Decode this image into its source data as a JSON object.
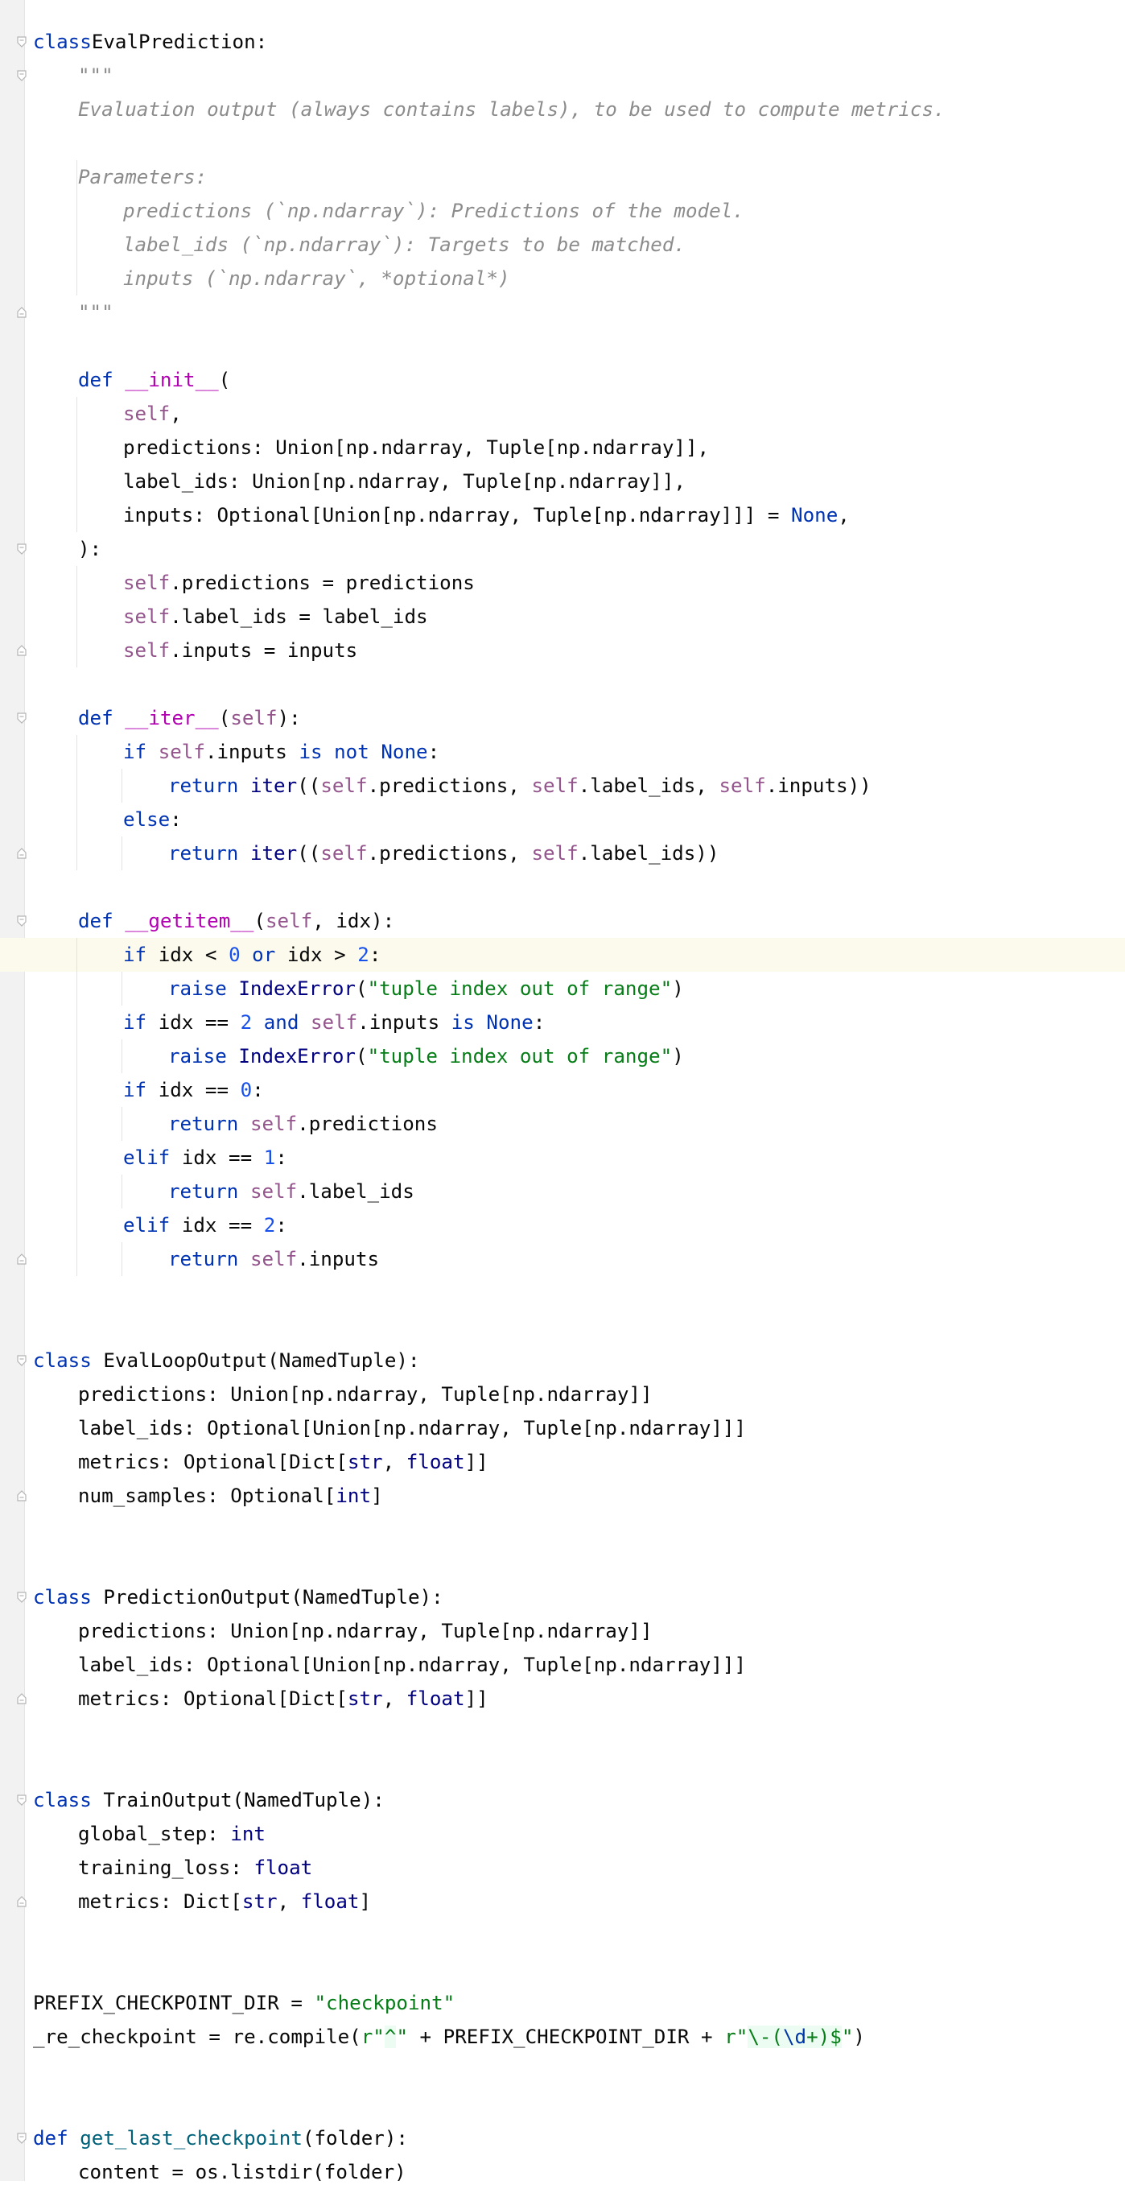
{
  "editor": {
    "current_line_index": 27,
    "lines": [
      {
        "indent": 0,
        "fold": "open",
        "tokens": [
          [
            "k",
            "class"
          ],
          [
            "",
            "EvalPrediction:"
          ]
        ]
      },
      {
        "indent": 1,
        "fold": "open",
        "tokens": [
          [
            "dc",
            "\"\"\""
          ]
        ]
      },
      {
        "indent": 1,
        "fold": "",
        "tokens": [
          [
            "dc",
            "Evaluation output (always contains labels), to be used to compute metrics."
          ]
        ]
      },
      {
        "indent": 0,
        "fold": "",
        "tokens": []
      },
      {
        "indent": 1,
        "fold": "",
        "tokens": [
          [
            "dc",
            "Parameters:"
          ]
        ]
      },
      {
        "indent": 2,
        "fold": "",
        "tokens": [
          [
            "dc",
            "predictions (`np.ndarray`): Predictions of the model."
          ]
        ]
      },
      {
        "indent": 2,
        "fold": "",
        "tokens": [
          [
            "dc",
            "label_ids (`np.ndarray`): Targets to be matched."
          ]
        ]
      },
      {
        "indent": 2,
        "fold": "",
        "tokens": [
          [
            "dc",
            "inputs (`np.ndarray`, *optional*)"
          ]
        ]
      },
      {
        "indent": 1,
        "fold": "close",
        "tokens": [
          [
            "dc",
            "\"\"\""
          ]
        ]
      },
      {
        "indent": 0,
        "fold": "",
        "tokens": []
      },
      {
        "indent": 1,
        "fold": "",
        "tokens": [
          [
            "k",
            "def "
          ],
          [
            "mg",
            "__init__"
          ],
          [
            "",
            "("
          ]
        ]
      },
      {
        "indent": 2,
        "fold": "",
        "tokens": [
          [
            "sf",
            "self"
          ],
          [
            "",
            ","
          ]
        ]
      },
      {
        "indent": 2,
        "fold": "",
        "tokens": [
          [
            "",
            "predictions: Union[np.ndarray, Tuple[np.ndarray]],"
          ]
        ]
      },
      {
        "indent": 2,
        "fold": "",
        "tokens": [
          [
            "",
            "label_ids: Union[np.ndarray, Tuple[np.ndarray]],"
          ]
        ]
      },
      {
        "indent": 2,
        "fold": "",
        "tokens": [
          [
            "",
            "inputs: Optional[Union[np.ndarray, Tuple[np.ndarray]]] = "
          ],
          [
            "k",
            "None"
          ],
          [
            "",
            ","
          ]
        ]
      },
      {
        "indent": 1,
        "fold": "open",
        "tokens": [
          [
            "",
            "):"
          ]
        ]
      },
      {
        "indent": 2,
        "fold": "",
        "tokens": [
          [
            "sf",
            "self"
          ],
          [
            "",
            ".predictions = predictions"
          ]
        ]
      },
      {
        "indent": 2,
        "fold": "",
        "tokens": [
          [
            "sf",
            "self"
          ],
          [
            "",
            ".label_ids = label_ids"
          ]
        ]
      },
      {
        "indent": 2,
        "fold": "close",
        "tokens": [
          [
            "sf",
            "self"
          ],
          [
            "",
            ".inputs = inputs"
          ]
        ]
      },
      {
        "indent": 0,
        "fold": "",
        "tokens": []
      },
      {
        "indent": 1,
        "fold": "open",
        "tokens": [
          [
            "k",
            "def "
          ],
          [
            "mg",
            "__iter__"
          ],
          [
            "",
            "("
          ],
          [
            "sf",
            "self"
          ],
          [
            "",
            "):"
          ]
        ]
      },
      {
        "indent": 2,
        "fold": "",
        "tokens": [
          [
            "k",
            "if "
          ],
          [
            "sf",
            "self"
          ],
          [
            "",
            ".inputs "
          ],
          [
            "k",
            "is not None"
          ],
          [
            "",
            ":"
          ]
        ]
      },
      {
        "indent": 3,
        "fold": "",
        "tokens": [
          [
            "k",
            "return "
          ],
          [
            "b",
            "iter"
          ],
          [
            "",
            "(("
          ],
          [
            "sf",
            "self"
          ],
          [
            "",
            ".predictions, "
          ],
          [
            "sf",
            "self"
          ],
          [
            "",
            ".label_ids, "
          ],
          [
            "sf",
            "self"
          ],
          [
            "",
            ".inputs))"
          ]
        ]
      },
      {
        "indent": 2,
        "fold": "",
        "tokens": [
          [
            "k",
            "else"
          ],
          [
            "",
            ":"
          ]
        ]
      },
      {
        "indent": 3,
        "fold": "close",
        "tokens": [
          [
            "k",
            "return "
          ],
          [
            "b",
            "iter"
          ],
          [
            "",
            "(("
          ],
          [
            "sf",
            "self"
          ],
          [
            "",
            ".predictions, "
          ],
          [
            "sf",
            "self"
          ],
          [
            "",
            ".label_ids))"
          ]
        ]
      },
      {
        "indent": 0,
        "fold": "",
        "tokens": []
      },
      {
        "indent": 1,
        "fold": "open",
        "tokens": [
          [
            "k",
            "def "
          ],
          [
            "mg",
            "__getitem__"
          ],
          [
            "",
            "("
          ],
          [
            "sf",
            "self"
          ],
          [
            "",
            ", idx):"
          ]
        ]
      },
      {
        "indent": 2,
        "fold": "",
        "tokens": [
          [
            "k",
            "if "
          ],
          [
            "",
            "idx < "
          ],
          [
            "nm",
            "0"
          ],
          [
            "k",
            " or "
          ],
          [
            "",
            "idx > "
          ],
          [
            "nm",
            "2"
          ],
          [
            "",
            ":"
          ]
        ]
      },
      {
        "indent": 3,
        "fold": "",
        "tokens": [
          [
            "k",
            "raise "
          ],
          [
            "b",
            "IndexError"
          ],
          [
            "",
            "("
          ],
          [
            "st",
            "\"tuple index out of range\""
          ],
          [
            "",
            ")"
          ]
        ]
      },
      {
        "indent": 2,
        "fold": "",
        "tokens": [
          [
            "k",
            "if "
          ],
          [
            "",
            "idx == "
          ],
          [
            "nm",
            "2"
          ],
          [
            "k",
            " and "
          ],
          [
            "sf",
            "self"
          ],
          [
            "",
            ".inputs "
          ],
          [
            "k",
            "is None"
          ],
          [
            "",
            ":"
          ]
        ]
      },
      {
        "indent": 3,
        "fold": "",
        "tokens": [
          [
            "k",
            "raise "
          ],
          [
            "b",
            "IndexError"
          ],
          [
            "",
            "("
          ],
          [
            "st",
            "\"tuple index out of range\""
          ],
          [
            "",
            ")"
          ]
        ]
      },
      {
        "indent": 2,
        "fold": "",
        "tokens": [
          [
            "k",
            "if "
          ],
          [
            "",
            "idx == "
          ],
          [
            "nm",
            "0"
          ],
          [
            "",
            ":"
          ]
        ]
      },
      {
        "indent": 3,
        "fold": "",
        "tokens": [
          [
            "k",
            "return "
          ],
          [
            "sf",
            "self"
          ],
          [
            "",
            ".predictions"
          ]
        ]
      },
      {
        "indent": 2,
        "fold": "",
        "tokens": [
          [
            "k",
            "elif "
          ],
          [
            "",
            "idx == "
          ],
          [
            "nm",
            "1"
          ],
          [
            "",
            ":"
          ]
        ]
      },
      {
        "indent": 3,
        "fold": "",
        "tokens": [
          [
            "k",
            "return "
          ],
          [
            "sf",
            "self"
          ],
          [
            "",
            ".label_ids"
          ]
        ]
      },
      {
        "indent": 2,
        "fold": "",
        "tokens": [
          [
            "k",
            "elif "
          ],
          [
            "",
            "idx == "
          ],
          [
            "nm",
            "2"
          ],
          [
            "",
            ":"
          ]
        ]
      },
      {
        "indent": 3,
        "fold": "close",
        "tokens": [
          [
            "k",
            "return "
          ],
          [
            "sf",
            "self"
          ],
          [
            "",
            ".inputs"
          ]
        ]
      },
      {
        "indent": 0,
        "fold": "",
        "tokens": []
      },
      {
        "indent": 0,
        "fold": "",
        "tokens": []
      },
      {
        "indent": 0,
        "fold": "open",
        "tokens": [
          [
            "k",
            "class "
          ],
          [
            "",
            "EvalLoopOutput(NamedTuple):"
          ]
        ]
      },
      {
        "indent": 1,
        "fold": "",
        "tokens": [
          [
            "",
            "predictions: Union[np.ndarray, Tuple[np.ndarray]]"
          ]
        ]
      },
      {
        "indent": 1,
        "fold": "",
        "tokens": [
          [
            "",
            "label_ids: Optional[Union[np.ndarray, Tuple[np.ndarray]]]"
          ]
        ]
      },
      {
        "indent": 1,
        "fold": "",
        "tokens": [
          [
            "",
            "metrics: Optional[Dict["
          ],
          [
            "b",
            "str"
          ],
          [
            "",
            ", "
          ],
          [
            "b",
            "float"
          ],
          [
            "",
            "]]"
          ]
        ]
      },
      {
        "indent": 1,
        "fold": "close",
        "tokens": [
          [
            "",
            "num_samples: Optional["
          ],
          [
            "b",
            "int"
          ],
          [
            "",
            "]"
          ]
        ]
      },
      {
        "indent": 0,
        "fold": "",
        "tokens": []
      },
      {
        "indent": 0,
        "fold": "",
        "tokens": []
      },
      {
        "indent": 0,
        "fold": "open",
        "tokens": [
          [
            "k",
            "class "
          ],
          [
            "",
            "PredictionOutput(NamedTuple):"
          ]
        ]
      },
      {
        "indent": 1,
        "fold": "",
        "tokens": [
          [
            "",
            "predictions: Union[np.ndarray, Tuple[np.ndarray]]"
          ]
        ]
      },
      {
        "indent": 1,
        "fold": "",
        "tokens": [
          [
            "",
            "label_ids: Optional[Union[np.ndarray, Tuple[np.ndarray]]]"
          ]
        ]
      },
      {
        "indent": 1,
        "fold": "close",
        "tokens": [
          [
            "",
            "metrics: Optional[Dict["
          ],
          [
            "b",
            "str"
          ],
          [
            "",
            ", "
          ],
          [
            "b",
            "float"
          ],
          [
            "",
            "]]"
          ]
        ]
      },
      {
        "indent": 0,
        "fold": "",
        "tokens": []
      },
      {
        "indent": 0,
        "fold": "",
        "tokens": []
      },
      {
        "indent": 0,
        "fold": "open",
        "tokens": [
          [
            "k",
            "class "
          ],
          [
            "",
            "TrainOutput(NamedTuple):"
          ]
        ]
      },
      {
        "indent": 1,
        "fold": "",
        "tokens": [
          [
            "",
            "global_step: "
          ],
          [
            "b",
            "int"
          ]
        ]
      },
      {
        "indent": 1,
        "fold": "",
        "tokens": [
          [
            "",
            "training_loss: "
          ],
          [
            "b",
            "float"
          ]
        ]
      },
      {
        "indent": 1,
        "fold": "close",
        "tokens": [
          [
            "",
            "metrics: Dict["
          ],
          [
            "b",
            "str"
          ],
          [
            "",
            ", "
          ],
          [
            "b",
            "float"
          ],
          [
            "",
            "]"
          ]
        ]
      },
      {
        "indent": 0,
        "fold": "",
        "tokens": []
      },
      {
        "indent": 0,
        "fold": "",
        "tokens": []
      },
      {
        "indent": 0,
        "fold": "",
        "tokens": [
          [
            "",
            "PREFIX_CHECKPOINT_DIR = "
          ],
          [
            "st",
            "\"checkpoint\""
          ]
        ]
      },
      {
        "indent": 0,
        "fold": "",
        "tokens": [
          [
            "",
            "_re_checkpoint = re.compile("
          ],
          [
            "st",
            "r\""
          ],
          [
            "rx",
            "^"
          ],
          [
            "st",
            "\""
          ],
          [
            "",
            " + PREFIX_CHECKPOINT_DIR + "
          ],
          [
            "st",
            "r\""
          ],
          [
            "rx",
            "\\-("
          ],
          [
            "re",
            "\\d"
          ],
          [
            "rx",
            "+)$"
          ],
          [
            "st",
            "\""
          ],
          [
            "",
            ")"
          ]
        ]
      },
      {
        "indent": 0,
        "fold": "",
        "tokens": []
      },
      {
        "indent": 0,
        "fold": "",
        "tokens": []
      },
      {
        "indent": 0,
        "fold": "open",
        "tokens": [
          [
            "k",
            "def "
          ],
          [
            "dn",
            "get_last_checkpoint"
          ],
          [
            "",
            "(folder):"
          ]
        ]
      },
      {
        "indent": 1,
        "fold": "",
        "tokens": [
          [
            "",
            "content = os.listdir(folder)"
          ]
        ]
      }
    ]
  },
  "indent_guides": [
    {
      "level": 1,
      "from": 4,
      "to": 7
    },
    {
      "level": 1,
      "from": 11,
      "to": 14
    },
    {
      "level": 1,
      "from": 16,
      "to": 18
    },
    {
      "level": 1,
      "from": 21,
      "to": 24
    },
    {
      "level": 2,
      "from": 22,
      "to": 22
    },
    {
      "level": 2,
      "from": 24,
      "to": 24
    },
    {
      "level": 1,
      "from": 27,
      "to": 36
    },
    {
      "level": 2,
      "from": 28,
      "to": 28
    },
    {
      "level": 2,
      "from": 30,
      "to": 30
    },
    {
      "level": 2,
      "from": 32,
      "to": 32
    },
    {
      "level": 2,
      "from": 34,
      "to": 34
    },
    {
      "level": 2,
      "from": 36,
      "to": 36
    }
  ],
  "colors": {
    "keyword": "#0033b3",
    "builtin": "#000080",
    "self": "#94558d",
    "dunder": "#b200b2",
    "function_name": "#00627a",
    "string": "#067d17",
    "number": "#1750eb",
    "docstring": "#8c8c8c",
    "current_line_bg": "#fcfaed",
    "gutter_bg": "#f2f2f2"
  }
}
